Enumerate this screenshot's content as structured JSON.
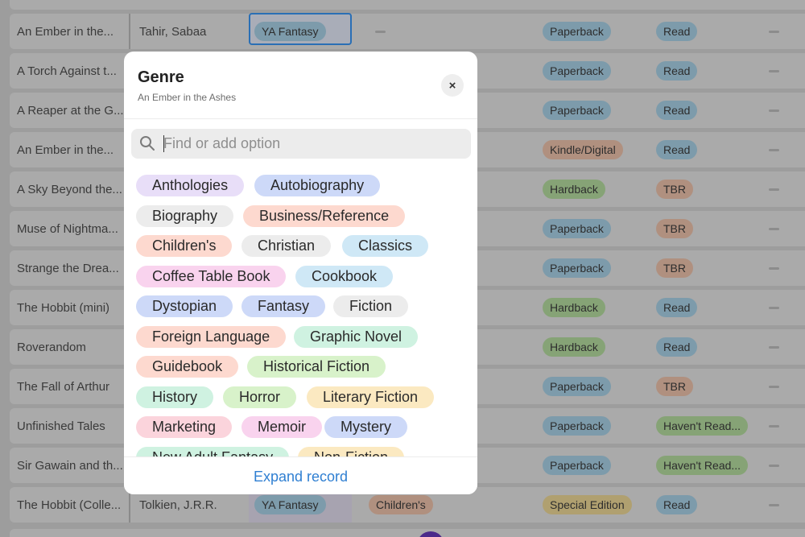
{
  "modal": {
    "title": "Genre",
    "subtitle": "An Ember in the Ashes",
    "close_label": "×",
    "search_placeholder": "Find or add option",
    "footer_link": "Expand record",
    "options": [
      {
        "label": "Anthologies",
        "color": "#e8def8"
      },
      {
        "label": "Autobiography",
        "color": "#cdd9f8"
      },
      {
        "label": "Biography",
        "color": "#ececec"
      },
      {
        "label": "Business/Reference",
        "color": "#fdd9cf"
      },
      {
        "label": "Children's",
        "color": "#fdd9cf"
      },
      {
        "label": "Christian",
        "color": "#ececec"
      },
      {
        "label": "Classics",
        "color": "#cfe8f6"
      },
      {
        "label": "Coffee Table Book",
        "color": "#f9d3ee"
      },
      {
        "label": "Cookbook",
        "color": "#cfe8f6"
      },
      {
        "label": "Dystopian",
        "color": "#cdd9f8"
      },
      {
        "label": "Fantasy",
        "color": "#cdd9f8"
      },
      {
        "label": "Fiction",
        "color": "#ececec"
      },
      {
        "label": "Foreign Language",
        "color": "#fdd9cf"
      },
      {
        "label": "Graphic Novel",
        "color": "#cff2e1"
      },
      {
        "label": "Guidebook",
        "color": "#fdd9cf"
      },
      {
        "label": "Historical Fiction",
        "color": "#d8f2ca"
      },
      {
        "label": "History",
        "color": "#cff2e1"
      },
      {
        "label": "Horror",
        "color": "#d8f2ca"
      },
      {
        "label": "Literary Fiction",
        "color": "#fbe9c1"
      },
      {
        "label": "Marketing",
        "color": "#fbd4dc"
      },
      {
        "label": "Memoir",
        "color": "#f9d3ee"
      },
      {
        "label": "Mystery",
        "color": "#cdd9f8"
      },
      {
        "label": "New Adult Fantasy",
        "color": "#cff2e1"
      },
      {
        "label": "Non-Fiction",
        "color": "#fbe9c1"
      }
    ]
  },
  "rows": [
    {
      "title": "An Ember in the...",
      "author": "Tahir, Sabaa",
      "genre": "YA Fantasy",
      "genre2": "",
      "format": "Paperback",
      "format_type": "paperback",
      "status": "Read",
      "status_type": "read"
    },
    {
      "title": "A Torch Against t...",
      "author": "",
      "genre": "",
      "genre2": "",
      "format": "Paperback",
      "format_type": "paperback",
      "status": "Read",
      "status_type": "read"
    },
    {
      "title": "A Reaper at the G...",
      "author": "",
      "genre": "",
      "genre2": "",
      "format": "Paperback",
      "format_type": "paperback",
      "status": "Read",
      "status_type": "read"
    },
    {
      "title": "An Ember in the...",
      "author": "",
      "genre": "",
      "genre2": "",
      "format": "Kindle/Digital",
      "format_type": "kindle",
      "status": "Read",
      "status_type": "read"
    },
    {
      "title": "A Sky Beyond the...",
      "author": "",
      "genre": "",
      "genre2": "",
      "format": "Hardback",
      "format_type": "hardback",
      "status": "TBR",
      "status_type": "tbr"
    },
    {
      "title": "Muse of Nightma...",
      "author": "",
      "genre": "",
      "genre2": "",
      "format": "Paperback",
      "format_type": "paperback",
      "status": "TBR",
      "status_type": "tbr"
    },
    {
      "title": "Strange the Drea...",
      "author": "",
      "genre": "",
      "genre2": "",
      "format": "Paperback",
      "format_type": "paperback",
      "status": "TBR",
      "status_type": "tbr"
    },
    {
      "title": "The Hobbit (mini)",
      "author": "",
      "genre": "",
      "genre2": "",
      "format": "Hardback",
      "format_type": "hardback",
      "status": "Read",
      "status_type": "read"
    },
    {
      "title": "Roverandom",
      "author": "",
      "genre": "",
      "genre2": "",
      "format": "Hardback",
      "format_type": "hardback",
      "status": "Read",
      "status_type": "read"
    },
    {
      "title": "The Fall of Arthur",
      "author": "",
      "genre": "",
      "genre2": "",
      "format": "Paperback",
      "format_type": "paperback",
      "status": "TBR",
      "status_type": "tbr"
    },
    {
      "title": "Unfinished Tales",
      "author": "",
      "genre": "",
      "genre2": "",
      "format": "Paperback",
      "format_type": "paperback",
      "status": "Haven't Read...",
      "status_type": "havent"
    },
    {
      "title": "Sir Gawain and th...",
      "author": "",
      "genre": "",
      "genre2": "",
      "format": "Paperback",
      "format_type": "paperback",
      "status": "Haven't Read...",
      "status_type": "havent"
    },
    {
      "title": "The Hobbit (Colle...",
      "author": "Tolkien, J.R.R.",
      "genre": "YA Fantasy",
      "genre2": "Children's",
      "format": "Special Edition",
      "format_type": "special",
      "status": "Read",
      "status_type": "read"
    }
  ]
}
